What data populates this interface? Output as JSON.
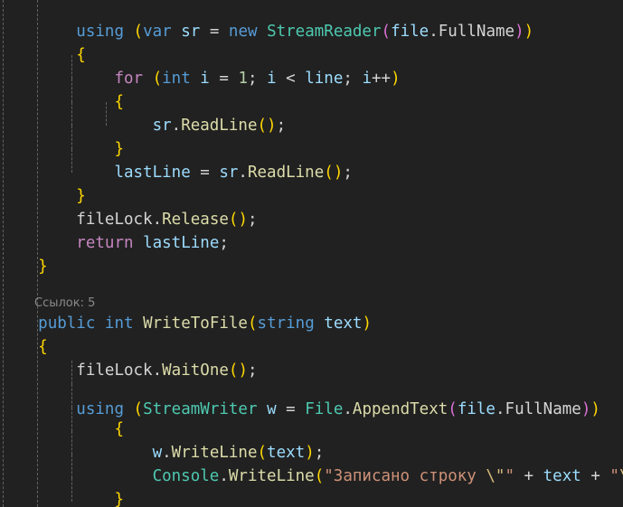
{
  "editor": {
    "language": "csharp",
    "theme": "dark-plus",
    "background_color": "#212121",
    "default_text_color": "#d4d4d4",
    "indent_guide_color": "#6e6e6e",
    "font_size_px": 17.5,
    "line_height_px": 26
  },
  "codelens": {
    "label": "Ссылок: 5",
    "color": "#8a8a8a",
    "reference_count": "5"
  },
  "lines": [
    {
      "n": 1,
      "text": "        using (var sr = new StreamReader(file.FullName))",
      "tokens": [
        {
          "t": "        ",
          "c": "punc"
        },
        {
          "t": "using",
          "c": "kw"
        },
        {
          "t": " ",
          "c": "punc"
        },
        {
          "t": "(",
          "c": "paren1"
        },
        {
          "t": "var",
          "c": "kw"
        },
        {
          "t": " ",
          "c": "punc"
        },
        {
          "t": "sr",
          "c": "var"
        },
        {
          "t": " = ",
          "c": "punc"
        },
        {
          "t": "new",
          "c": "kw"
        },
        {
          "t": " ",
          "c": "punc"
        },
        {
          "t": "StreamReader",
          "c": "type"
        },
        {
          "t": "(",
          "c": "paren2"
        },
        {
          "t": "file",
          "c": "var"
        },
        {
          "t": ".",
          "c": "punc"
        },
        {
          "t": "FullName",
          "c": "field"
        },
        {
          "t": ")",
          "c": "paren2"
        },
        {
          "t": ")",
          "c": "paren1"
        }
      ]
    },
    {
      "n": 2,
      "text": "        {",
      "tokens": [
        {
          "t": "        ",
          "c": "punc"
        },
        {
          "t": "{",
          "c": "paren1"
        }
      ]
    },
    {
      "n": 3,
      "text": "            for (int i = 1; i < line; i++)",
      "tokens": [
        {
          "t": "            ",
          "c": "punc"
        },
        {
          "t": "for",
          "c": "ctl"
        },
        {
          "t": " ",
          "c": "punc"
        },
        {
          "t": "(",
          "c": "paren1"
        },
        {
          "t": "int",
          "c": "kw"
        },
        {
          "t": " ",
          "c": "punc"
        },
        {
          "t": "i",
          "c": "var"
        },
        {
          "t": " = ",
          "c": "punc"
        },
        {
          "t": "1",
          "c": "num"
        },
        {
          "t": "; ",
          "c": "punc"
        },
        {
          "t": "i",
          "c": "var"
        },
        {
          "t": " < ",
          "c": "punc"
        },
        {
          "t": "line",
          "c": "var"
        },
        {
          "t": "; ",
          "c": "punc"
        },
        {
          "t": "i",
          "c": "var"
        },
        {
          "t": "++",
          "c": "punc"
        },
        {
          "t": ")",
          "c": "paren1"
        }
      ]
    },
    {
      "n": 4,
      "text": "            {",
      "tokens": [
        {
          "t": "            ",
          "c": "punc"
        },
        {
          "t": "{",
          "c": "paren1"
        }
      ]
    },
    {
      "n": 5,
      "text": "                sr.ReadLine();",
      "tokens": [
        {
          "t": "                ",
          "c": "punc"
        },
        {
          "t": "sr",
          "c": "var"
        },
        {
          "t": ".",
          "c": "punc"
        },
        {
          "t": "ReadLine",
          "c": "method"
        },
        {
          "t": "(",
          "c": "paren1"
        },
        {
          "t": ")",
          "c": "paren1"
        },
        {
          "t": ";",
          "c": "punc"
        }
      ]
    },
    {
      "n": 6,
      "text": "            }",
      "tokens": [
        {
          "t": "            ",
          "c": "punc"
        },
        {
          "t": "}",
          "c": "paren1"
        }
      ]
    },
    {
      "n": 7,
      "text": "            lastLine = sr.ReadLine();",
      "tokens": [
        {
          "t": "            ",
          "c": "punc"
        },
        {
          "t": "lastLine",
          "c": "var"
        },
        {
          "t": " = ",
          "c": "punc"
        },
        {
          "t": "sr",
          "c": "var"
        },
        {
          "t": ".",
          "c": "punc"
        },
        {
          "t": "ReadLine",
          "c": "method"
        },
        {
          "t": "(",
          "c": "paren1"
        },
        {
          "t": ")",
          "c": "paren1"
        },
        {
          "t": ";",
          "c": "punc"
        }
      ]
    },
    {
      "n": 8,
      "text": "        }",
      "tokens": [
        {
          "t": "        ",
          "c": "punc"
        },
        {
          "t": "}",
          "c": "paren1"
        }
      ]
    },
    {
      "n": 9,
      "text": "        fileLock.Release();",
      "tokens": [
        {
          "t": "        ",
          "c": "punc"
        },
        {
          "t": "fileLock",
          "c": "field"
        },
        {
          "t": ".",
          "c": "punc"
        },
        {
          "t": "Release",
          "c": "method"
        },
        {
          "t": "(",
          "c": "paren1"
        },
        {
          "t": ")",
          "c": "paren1"
        },
        {
          "t": ";",
          "c": "punc"
        }
      ]
    },
    {
      "n": 10,
      "text": "",
      "tokens": []
    },
    {
      "n": 11,
      "text": "        return lastLine;",
      "tokens": [
        {
          "t": "        ",
          "c": "punc"
        },
        {
          "t": "return",
          "c": "ctl"
        },
        {
          "t": " ",
          "c": "punc"
        },
        {
          "t": "lastLine",
          "c": "var"
        },
        {
          "t": ";",
          "c": "punc"
        }
      ]
    },
    {
      "n": 12,
      "text": "    }",
      "tokens": [
        {
          "t": "    ",
          "c": "punc"
        },
        {
          "t": "}",
          "c": "paren1"
        }
      ]
    },
    {
      "n": 13,
      "text": "",
      "tokens": []
    },
    {
      "n": 14,
      "text": "    public int WriteToFile(string text)",
      "tokens": [
        {
          "t": "    ",
          "c": "punc"
        },
        {
          "t": "public",
          "c": "kw"
        },
        {
          "t": " ",
          "c": "punc"
        },
        {
          "t": "int",
          "c": "kw"
        },
        {
          "t": " ",
          "c": "punc"
        },
        {
          "t": "WriteToFile",
          "c": "method"
        },
        {
          "t": "(",
          "c": "paren1"
        },
        {
          "t": "string",
          "c": "kw"
        },
        {
          "t": " ",
          "c": "punc"
        },
        {
          "t": "text",
          "c": "var"
        },
        {
          "t": ")",
          "c": "paren1"
        }
      ]
    },
    {
      "n": 15,
      "text": "    {",
      "tokens": [
        {
          "t": "    ",
          "c": "punc"
        },
        {
          "t": "{",
          "c": "paren1"
        }
      ]
    },
    {
      "n": 16,
      "text": "        fileLock.WaitOne();",
      "tokens": [
        {
          "t": "        ",
          "c": "punc"
        },
        {
          "t": "fileLock",
          "c": "field"
        },
        {
          "t": ".",
          "c": "punc"
        },
        {
          "t": "WaitOne",
          "c": "method"
        },
        {
          "t": "(",
          "c": "paren1"
        },
        {
          "t": ")",
          "c": "paren1"
        },
        {
          "t": ";",
          "c": "punc"
        }
      ]
    },
    {
      "n": 17,
      "text": "",
      "tokens": []
    },
    {
      "n": 18,
      "text": "        using (StreamWriter w = File.AppendText(file.FullName))",
      "tokens": [
        {
          "t": "        ",
          "c": "punc"
        },
        {
          "t": "using",
          "c": "kw"
        },
        {
          "t": " ",
          "c": "punc"
        },
        {
          "t": "(",
          "c": "paren1"
        },
        {
          "t": "StreamWriter",
          "c": "type"
        },
        {
          "t": " ",
          "c": "punc"
        },
        {
          "t": "w",
          "c": "var"
        },
        {
          "t": " = ",
          "c": "punc"
        },
        {
          "t": "File",
          "c": "type"
        },
        {
          "t": ".",
          "c": "punc"
        },
        {
          "t": "AppendText",
          "c": "method"
        },
        {
          "t": "(",
          "c": "paren2"
        },
        {
          "t": "file",
          "c": "var"
        },
        {
          "t": ".",
          "c": "punc"
        },
        {
          "t": "FullName",
          "c": "field"
        },
        {
          "t": ")",
          "c": "paren2"
        },
        {
          "t": ")",
          "c": "paren1"
        }
      ]
    },
    {
      "n": 19,
      "text": "            {",
      "tokens": [
        {
          "t": "            ",
          "c": "punc"
        },
        {
          "t": "{",
          "c": "paren1"
        }
      ]
    },
    {
      "n": 20,
      "text": "                w.WriteLine(text);",
      "tokens": [
        {
          "t": "                ",
          "c": "punc"
        },
        {
          "t": "w",
          "c": "var"
        },
        {
          "t": ".",
          "c": "punc"
        },
        {
          "t": "WriteLine",
          "c": "method"
        },
        {
          "t": "(",
          "c": "paren1"
        },
        {
          "t": "text",
          "c": "var"
        },
        {
          "t": ")",
          "c": "paren1"
        },
        {
          "t": ";",
          "c": "punc"
        }
      ]
    },
    {
      "n": 21,
      "text": "                Console.WriteLine(\"Записано строку \\\"\" + text + \"\\\"\");",
      "tokens": [
        {
          "t": "                ",
          "c": "punc"
        },
        {
          "t": "Console",
          "c": "type"
        },
        {
          "t": ".",
          "c": "punc"
        },
        {
          "t": "WriteLine",
          "c": "method"
        },
        {
          "t": "(",
          "c": "paren1"
        },
        {
          "t": "\"Записано строку ",
          "c": "str"
        },
        {
          "t": "\\\"",
          "c": "esc"
        },
        {
          "t": "\"",
          "c": "str"
        },
        {
          "t": " + ",
          "c": "punc"
        },
        {
          "t": "text",
          "c": "var"
        },
        {
          "t": " + ",
          "c": "punc"
        },
        {
          "t": "\"",
          "c": "str"
        },
        {
          "t": "\\\"",
          "c": "esc"
        },
        {
          "t": "\"",
          "c": "str"
        },
        {
          "t": ")",
          "c": "paren1"
        },
        {
          "t": ";",
          "c": "punc"
        }
      ]
    },
    {
      "n": 22,
      "text": "            }",
      "tokens": [
        {
          "t": "            ",
          "c": "punc"
        },
        {
          "t": "}",
          "c": "paren1"
        }
      ]
    }
  ]
}
